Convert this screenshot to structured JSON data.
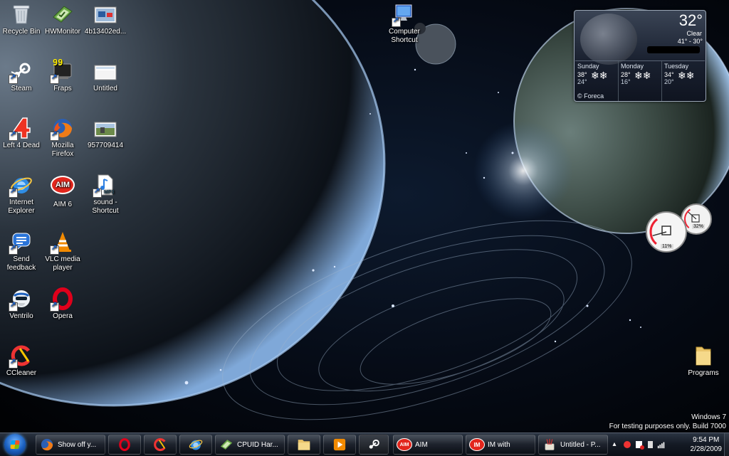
{
  "desktop": {
    "icons": [
      {
        "label": "Recycle Bin",
        "icon": "recycle-bin-icon"
      },
      {
        "label": "HWMonitor",
        "icon": "hwmonitor-icon"
      },
      {
        "label": "4b13402ed...",
        "icon": "image-file-icon"
      },
      {
        "label": "Steam",
        "icon": "steam-icon"
      },
      {
        "label": "Fraps",
        "icon": "fraps-icon",
        "badge": "99"
      },
      {
        "label": "Untitled",
        "icon": "image-file-icon"
      },
      {
        "label": "Left 4 Dead",
        "icon": "left4dead-icon"
      },
      {
        "label": "Mozilla Firefox",
        "icon": "firefox-icon"
      },
      {
        "label": "957709414",
        "icon": "image-file-icon"
      },
      {
        "label": "Internet Explorer",
        "icon": "internet-explorer-icon"
      },
      {
        "label": "AIM 6",
        "icon": "aim-icon",
        "badge": "AIM"
      },
      {
        "label": "sound - Shortcut",
        "icon": "mp3-file-icon",
        "badge": "MP3"
      },
      {
        "label": "Send feedback",
        "icon": "feedback-icon"
      },
      {
        "label": "VLC media player",
        "icon": "vlc-icon"
      },
      {
        "label": "Ventrilo",
        "icon": "ventrilo-icon"
      },
      {
        "label": "Opera",
        "icon": "opera-icon"
      },
      {
        "label": "CCleaner",
        "icon": "ccleaner-icon"
      },
      {
        "label": "Computer Shortcut",
        "icon": "computer-icon"
      },
      {
        "label": "Programs",
        "icon": "folder-icon"
      }
    ]
  },
  "weather": {
    "temp": "32°",
    "condition": "Clear",
    "range": "41° - 30°",
    "days": [
      {
        "name": "Sunday",
        "hi": "38°",
        "lo": "24°",
        "icon": "snow-icon"
      },
      {
        "name": "Monday",
        "hi": "28°",
        "lo": "16°",
        "icon": "snow-icon"
      },
      {
        "name": "Tuesday",
        "hi": "34°",
        "lo": "20°",
        "icon": "snow-icon"
      }
    ],
    "brand": "© Foreca"
  },
  "meter": {
    "cpu_label": "11%",
    "mem_label": "32%",
    "cpu_fraction": 0.11,
    "mem_fraction": 0.32
  },
  "watermark": {
    "line1": "Windows 7",
    "line2": "For testing purposes only. Build 7000"
  },
  "taskbar": {
    "buttons": [
      {
        "label": "Show off y...",
        "icon": "firefox-icon"
      },
      {
        "label": "",
        "icon": "opera-icon"
      },
      {
        "label": "",
        "icon": "ccleaner-icon"
      },
      {
        "label": "",
        "icon": "internet-explorer-icon"
      },
      {
        "label": "CPUID Har...",
        "icon": "hwmonitor-icon"
      },
      {
        "label": "",
        "icon": "folder-icon"
      },
      {
        "label": "",
        "icon": "media-player-icon"
      },
      {
        "label": "",
        "icon": "steam-icon"
      },
      {
        "label": "AIM",
        "icon": "aim-icon"
      },
      {
        "label": "IM with",
        "icon": "aim-im-icon"
      },
      {
        "label": "Untitled - P...",
        "icon": "paint-icon"
      }
    ],
    "clock": {
      "time": "9:54 PM",
      "date": "2/28/2009"
    }
  },
  "colors": {
    "taskbar": "#141a24",
    "accent": "#1a5fbf"
  }
}
